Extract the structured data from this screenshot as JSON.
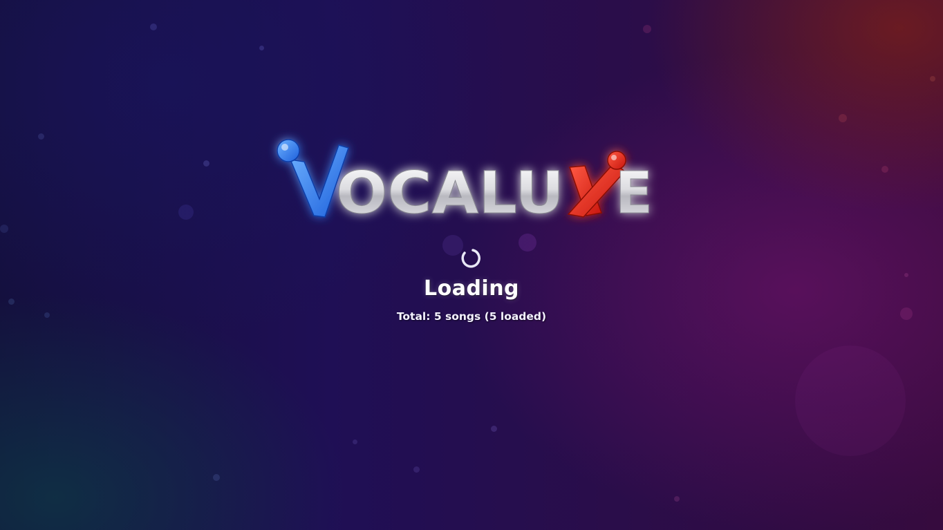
{
  "logo": {
    "text": "VOCALUXE",
    "letters": [
      "V",
      "O",
      "C",
      "A",
      "L",
      "U",
      "X",
      "E"
    ],
    "accent_left": "#2f7bf0",
    "accent_right": "#e8291e",
    "letter_color": "#d9d9dc"
  },
  "loading": {
    "title": "Loading",
    "status": "Total: 5 songs (5 loaded)",
    "spinner_icon": "spinner-icon"
  }
}
